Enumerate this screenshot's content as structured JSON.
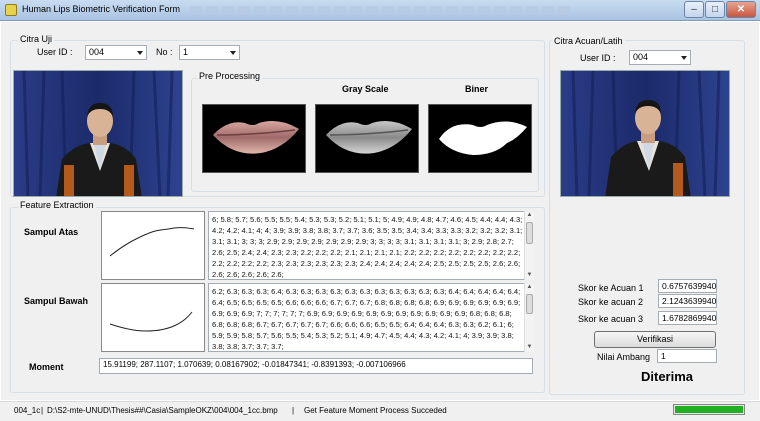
{
  "window": {
    "title": "Human Lips Biometric Verification Form",
    "minimize": "–",
    "maximize": "□",
    "close": "✕"
  },
  "citra_uji": {
    "group_title": "Citra Uji",
    "user_id_label": "User ID :",
    "user_id_value": "004",
    "no_label": "No :",
    "no_value": "1"
  },
  "preprocessing": {
    "group_title": "Pre Processing",
    "gray_label": "Gray Scale",
    "biner_label": "Biner"
  },
  "citra_acuan": {
    "group_title": "Citra Acuan/Latih",
    "user_id_label": "User ID :",
    "user_id_value": "004"
  },
  "feature": {
    "group_title": "Feature Extraction",
    "atas_label": "Sampul Atas",
    "bawah_label": "Sampul Bawah",
    "moment_label": "Moment",
    "atas_text": "6; 5.8; 5.7; 5.6; 5.5; 5.5; 5.4; 5.3; 5.3; 5.2; 5.1; 5.1; 5; 4.9; 4.9; 4.8; 4.7; 4.6; 4.5; 4.4; 4.4; 4.3; 4.2; 4.2; 4.1; 4; 4; 3.9; 3.9; 3.8; 3.8; 3.7; 3.7; 3.6; 3.5; 3.5; 3.4; 3.4; 3.3; 3.3; 3.2; 3.2; 3.2; 3.1; 3.1; 3.1; 3; 3; 3; 2.9; 2.9; 2.9; 2.9; 2.9; 2.9; 2.9; 3; 3; 3; 3; 3.1; 3.1; 3.1; 3.1; 3; 2.9; 2.8; 2.7; 2.6; 2.5; 2.4; 2.4; 2.3; 2.3; 2.2; 2.2; 2.2; 2.1; 2.1; 2.1; 2.1; 2.2; 2.2; 2.2; 2.2; 2.2; 2.2; 2.2; 2.2; 2.2; 2.2; 2.2; 2.2; 2.3; 2.3; 2.3; 2.3; 2.3; 2.3; 2.4; 2.4; 2.4; 2.4; 2.4; 2.5; 2.5; 2.5; 2.5; 2.6; 2.6; 2.6; 2.6; 2.6; 2.6; 2.6;",
    "bawah_text": "6.2; 6.3; 6.3; 6.3; 6.4; 6.3; 6.3; 6.3; 6.3; 6.3; 6.3; 6.3; 6.3; 6.3; 6.3; 6.3; 6.4; 6.4; 6.4; 6.4; 6.4; 6.4; 6.5; 6.5; 6.5; 6.5; 6.6; 6.6; 6.6; 6.7; 6.7; 6.7; 6.8; 6.8; 6.8; 6.8; 6.9; 6.9; 6.9; 6.9; 6.9; 6.9; 6.9; 6.9; 6.9; 7; 7; 7; 7; 7; 7; 6.9; 6.9; 6.9; 6.9; 6.9; 6.9; 6.9; 6.9; 6.9; 6.9; 6.9; 6.8; 6.8; 6.8; 6.8; 6.8; 6.8; 6.7; 6.7; 6.7; 6.7; 6.7; 6.6; 6.6; 6.6; 6.5; 6.5; 6.4; 6.4; 6.4; 6.3; 6.3; 6.2; 6.1; 6; 5.9; 5.9; 5.8; 5.7; 5.6; 5.5; 5.4; 5.3; 5.2; 5.1; 4.9; 4.7; 4.5; 4.4; 4.3; 4.2; 4.1; 4; 3.9; 3.9; 3.8; 3.8; 3.8; 3.7; 3.7; 3.7;",
    "moment_text": "15.91199; 287.1107; 1.070639; 0.08167902; -0.01847341; -0.8391393; -0.007106966"
  },
  "scores": {
    "skor1_label": "Skor ke Acuan 1",
    "skor1_value": "0.6757639940",
    "skor2_label": "Skor ke acuan 2",
    "skor2_value": "2.1243639940",
    "skor3_label": "Skor ke acuan 3",
    "skor3_value": "1.6782869940",
    "verify_button": "Verifikasi",
    "ambang_label": "Nilai Ambang",
    "ambang_value": "1",
    "result": "Diterima"
  },
  "status": {
    "file": "004_1c",
    "path": "D:\\S2-mte-UNUD\\Thesis##\\Casia\\SampleOKZ\\004\\004_1cc.bmp",
    "message": "Get Feature Moment Process Succeded",
    "progress": 1.0,
    "progress_color": "#22b022"
  },
  "icons": {
    "app": "form-icon",
    "combo": "chevron-down-icon"
  }
}
